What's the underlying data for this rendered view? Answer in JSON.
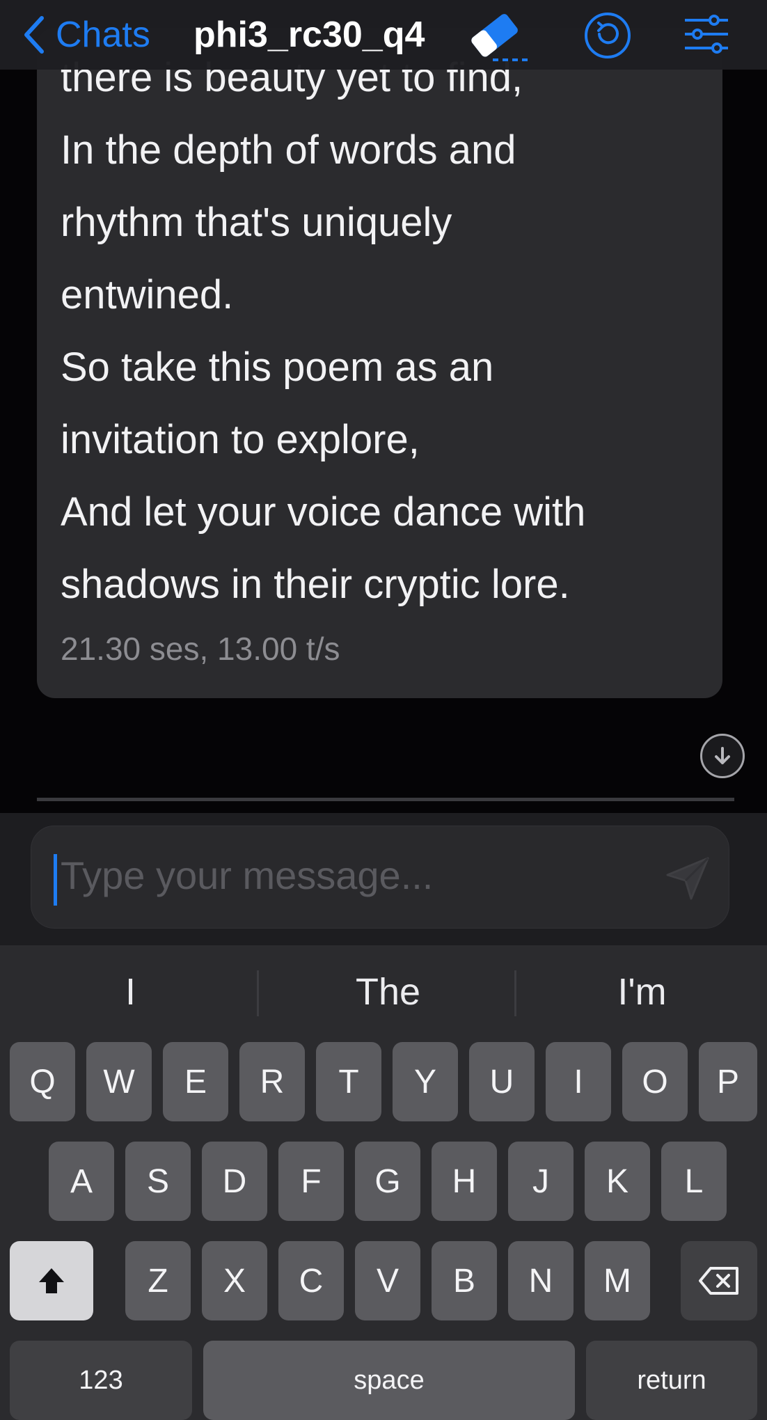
{
  "nav": {
    "back_label": "Chats",
    "title": "phi3_rc30_q4",
    "accent_color": "#1e7cf2",
    "icons": [
      "chevron-left-icon",
      "eraser-icon",
      "reload-icon",
      "settings-sliders-icon"
    ]
  },
  "message": {
    "lines": [
      "there is beauty yet to find,",
      "In the depth of words and",
      "rhythm that's uniquely",
      "entwined.",
      "So take this poem as an",
      "invitation to explore,",
      "And let your voice dance with",
      "shadows in their cryptic lore."
    ],
    "meta": "21.30 ses, 13.00 t/s"
  },
  "input": {
    "placeholder": "Type your message..."
  },
  "keyboard": {
    "suggestions": [
      "I",
      "The",
      "I'm"
    ],
    "row1": [
      "Q",
      "W",
      "E",
      "R",
      "T",
      "Y",
      "U",
      "I",
      "O",
      "P"
    ],
    "row2": [
      "A",
      "S",
      "D",
      "F",
      "G",
      "H",
      "J",
      "K",
      "L"
    ],
    "row3": [
      "Z",
      "X",
      "C",
      "V",
      "B",
      "N",
      "M"
    ],
    "numbers_label": "123",
    "space_label": "space",
    "return_label": "return"
  }
}
